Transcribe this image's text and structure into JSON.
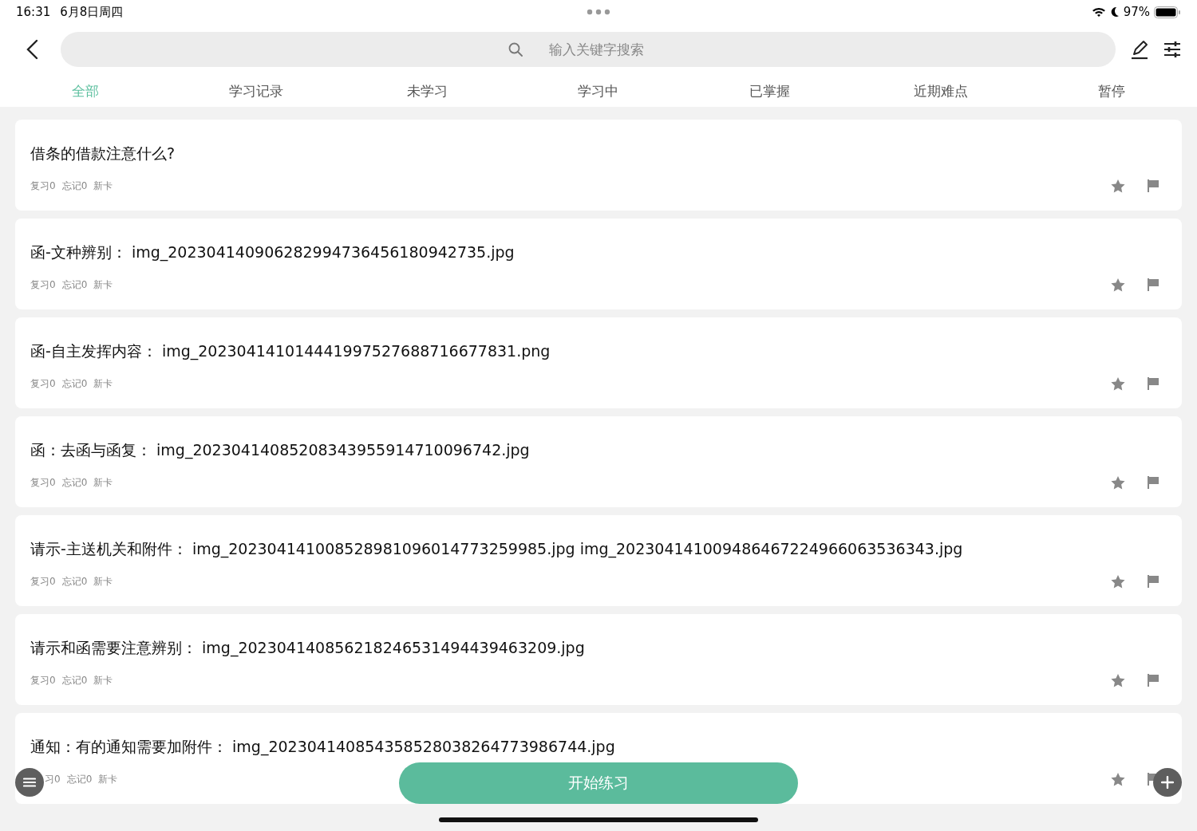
{
  "status_bar": {
    "time": "16:31",
    "date": "6月8日周四",
    "battery": "97%"
  },
  "search": {
    "placeholder": "输入关键字搜索"
  },
  "tabs": [
    {
      "label": "全部",
      "selected": true
    },
    {
      "label": "学习记录",
      "selected": false
    },
    {
      "label": "未学习",
      "selected": false
    },
    {
      "label": "学习中",
      "selected": false
    },
    {
      "label": "已掌握",
      "selected": false
    },
    {
      "label": "近期难点",
      "selected": false
    },
    {
      "label": "暂停",
      "selected": false
    }
  ],
  "cards": [
    {
      "title": "借条的借款注意什么?",
      "review": "复习0",
      "forget": "忘记0",
      "status": "新卡"
    },
    {
      "title": "函-文种辨别：  img_20230414090628299473645618094​2735.jpg",
      "review": "复习0",
      "forget": "忘记0",
      "status": "新卡"
    },
    {
      "title": "函-自主发挥内容：  img_20230414101444199752768871667​7831.png",
      "review": "复习0",
      "forget": "忘记0",
      "status": "新卡"
    },
    {
      "title": "函：去函与函复：  img_20230414085208343955914710096742.jpg",
      "review": "复习0",
      "forget": "忘记0",
      "status": "新卡"
    },
    {
      "title": "请示-主送机关和附件：  img_20230414100852898109601477325​9985.jpg  img_20230414100948646722496606353​6343.jpg",
      "review": "复习0",
      "forget": "忘记0",
      "status": "新卡"
    },
    {
      "title": "请示和函需要注意辨别：  img_20230414085621824653149443946​3209.jpg",
      "review": "复习0",
      "forget": "忘记0",
      "status": "新卡"
    },
    {
      "title": "通知：有的通知需要加附件：  img_20230414085435852803826477398​6744.jpg",
      "review": "习0",
      "forget": "忘记0",
      "status": "新卡"
    }
  ],
  "start_button": "开始练习"
}
